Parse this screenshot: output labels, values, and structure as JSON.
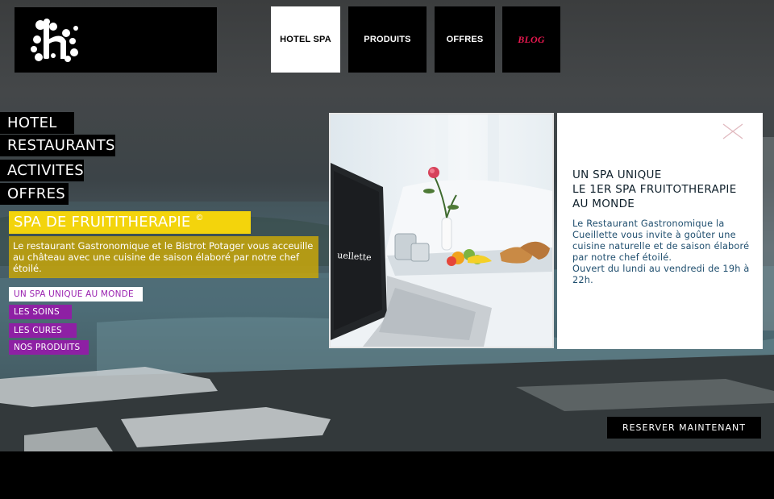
{
  "topnav": {
    "items": [
      {
        "label": "HOTEL SPA"
      },
      {
        "label": "PRODUITS"
      },
      {
        "label": "OFFRES"
      },
      {
        "label": "BLOG"
      }
    ]
  },
  "sidebar": {
    "items": [
      {
        "label": "HOTEL"
      },
      {
        "label": "RESTAURANTS"
      },
      {
        "label": "ACTIVITES"
      },
      {
        "label": "OFFRES"
      }
    ]
  },
  "section": {
    "title": "SPA DE FRUITITHERAPIE",
    "title_mark": "©",
    "description": "Le restaurant Gastronomique et le Bistrot Potager vous acceuille au château avec une cuisine de saison élaboré par notre chef étoilé.",
    "subnav": [
      {
        "label": "UN SPA UNIQUE AU MONDE"
      },
      {
        "label": "LES SOINS"
      },
      {
        "label": "LES CURES"
      },
      {
        "label": "NOS PRODUITS"
      }
    ]
  },
  "panel": {
    "heading_lines": [
      "UN SPA UNIQUE",
      "LE 1ER SPA FRUITOTHERAPIE",
      "AU MONDE"
    ],
    "body": "Le Restaurant Gastronomique la Cueillette vous invite à goûter une cuisine naturelle et de saison élaboré par notre chef étoilé.",
    "hours": "Ouvert du lundi au vendredi de 19h à 22h."
  },
  "photo": {
    "screen_text": "uellette"
  },
  "cta": {
    "label": "RESERVER MAINTENANT"
  },
  "colors": {
    "accent_yellow": "#f3d40c",
    "accent_purple": "#8e20a4",
    "blog_red": "#e8184f"
  }
}
